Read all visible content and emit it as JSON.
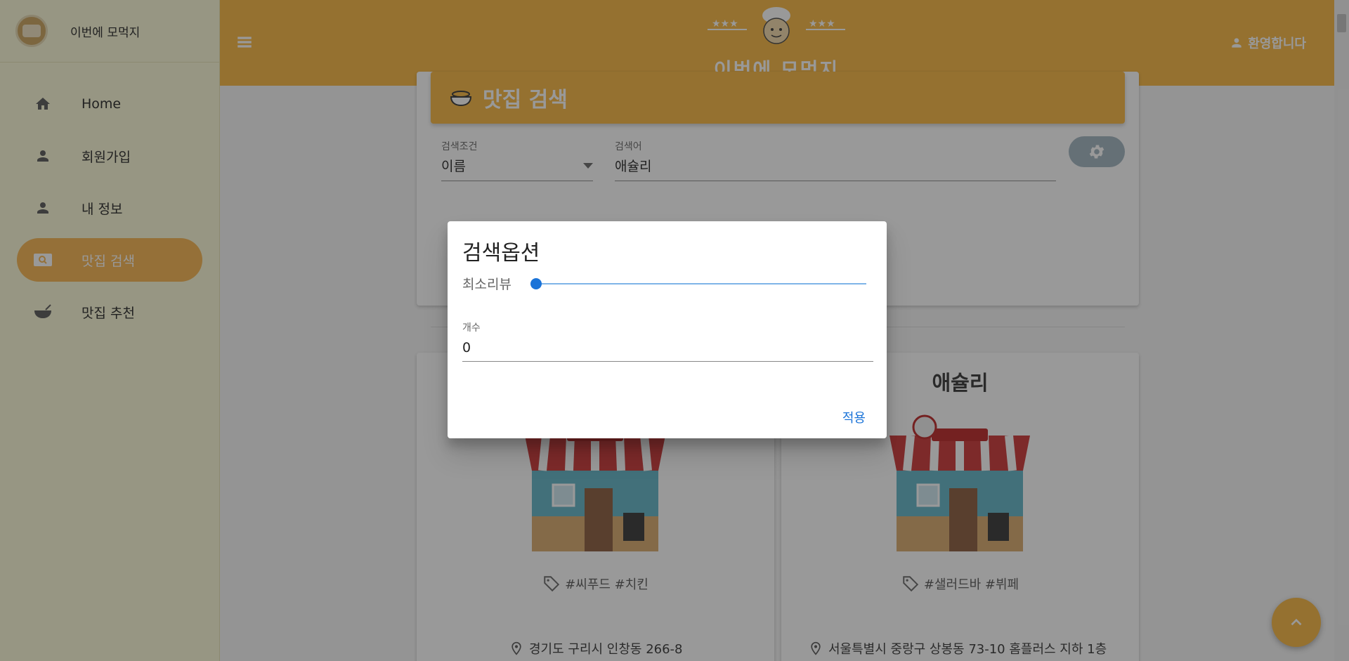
{
  "sidebar": {
    "title": "이번에 모먹지",
    "items": [
      {
        "label": "Home",
        "icon": "home-icon"
      },
      {
        "label": "회원가입",
        "icon": "person-icon"
      },
      {
        "label": "내 정보",
        "icon": "person-icon"
      },
      {
        "label": "맛집 검색",
        "icon": "search-icon",
        "active": true
      },
      {
        "label": "맛집 추천",
        "icon": "bowl-icon"
      }
    ]
  },
  "header": {
    "title": "이번에 모먹지",
    "welcome": "환영합니다"
  },
  "search": {
    "title": "맛집 검색",
    "condition_label": "검색조건",
    "condition_value": "이름",
    "keyword_label": "검색어",
    "keyword_value": "애슐리"
  },
  "cards": [
    {
      "title": "",
      "tags": "#씨푸드 #치킨",
      "address": "경기도 구리시 인창동 266-8"
    },
    {
      "title": "애슐리",
      "tags": "#샐러드바 #뷔페",
      "address": "서울특별시 중랑구 상봉동 73-10 홈플러스 지하 1층"
    }
  ],
  "dialog": {
    "title": "검색옵션",
    "slider_label": "최소리뷰",
    "slider_value": 0,
    "count_label": "개수",
    "count_value": "0",
    "apply": "적용"
  },
  "colors": {
    "accent": "#f7b53d",
    "sidebar_bg": "#fbf9d6",
    "primary_blue": "#1a73d8"
  }
}
